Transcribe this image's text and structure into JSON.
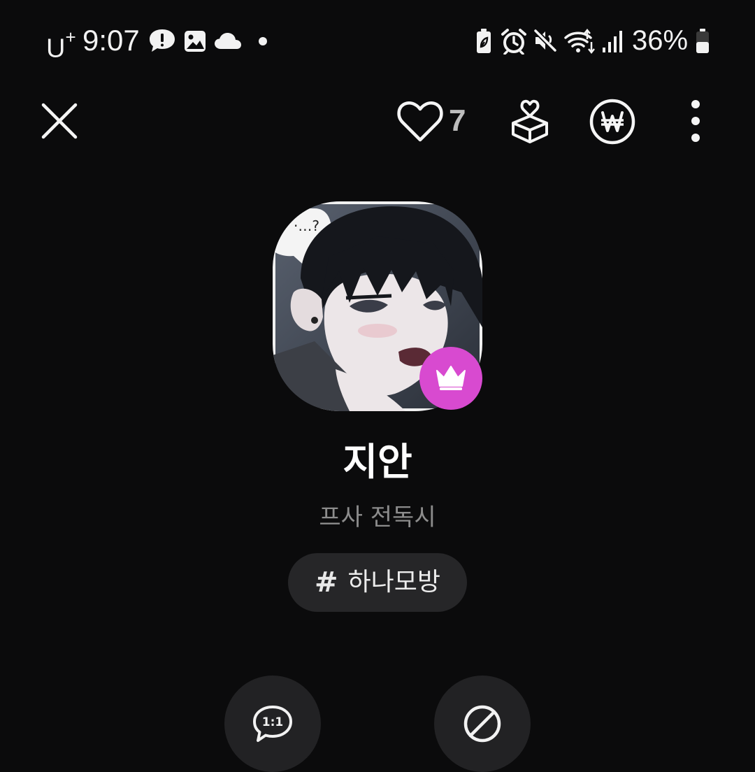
{
  "status_bar": {
    "carrier": "U",
    "carrier_sup": "+",
    "time": "9:07",
    "battery_percent": "36%",
    "left_icons": [
      "alert-bubble-icon",
      "image-icon",
      "cloud-icon",
      "dot-icon"
    ],
    "right_icons": [
      "battery-saver-icon",
      "alarm-icon",
      "mute-icon",
      "wifi-icon",
      "signal-icon",
      "battery-icon"
    ]
  },
  "top_bar": {
    "close_icon": "close-icon",
    "like_icon": "heart-icon",
    "like_count": "7",
    "gift_icon": "gift-heart-icon",
    "won_icon": "won-coin-icon",
    "more_icon": "more-vertical-icon"
  },
  "profile": {
    "avatar_badge_icon": "crown-icon",
    "name": "지안",
    "status_message": "프사 전독시",
    "tag": {
      "hash": "#",
      "label": "하나모방"
    }
  },
  "actions": [
    {
      "icon": "one-to-one-chat-icon",
      "icon_text": "1:1"
    },
    {
      "icon": "block-icon"
    }
  ],
  "colors": {
    "background": "#0b0b0c",
    "badge": "#d84ad0",
    "chip": "#262628",
    "muted_text": "#8c8c8c"
  }
}
